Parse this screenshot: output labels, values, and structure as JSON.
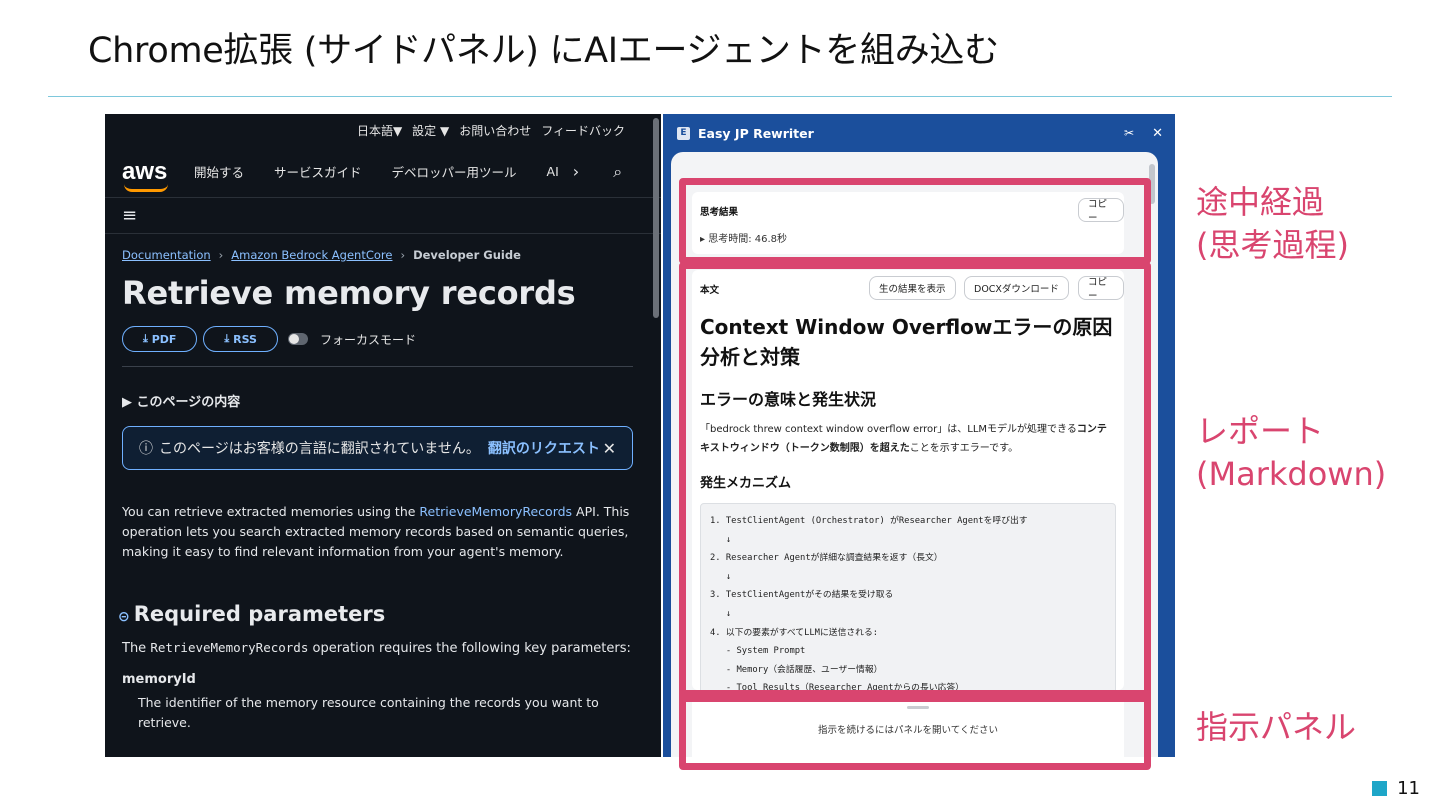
{
  "slide": {
    "title": "Chrome拡張 (サイドパネル) にAIエージェントを組み込む",
    "page_number": "11",
    "accent_color": "#1ea6c8",
    "highlight_color": "#d9456f"
  },
  "annotations": {
    "thinking": [
      "途中経過",
      "(思考過程)"
    ],
    "report": [
      "レポート",
      "(Markdown)"
    ],
    "instruction": "指示パネル"
  },
  "aws": {
    "topbar": {
      "language": "日本語▼",
      "settings": "設定 ▼",
      "contact": "お問い合わせ",
      "feedback": "フィードバック"
    },
    "logo": "aws",
    "nav": [
      "開始する",
      "サービスガイド",
      "デベロッパー用ツール",
      "AI"
    ],
    "menu_icon": "≡",
    "breadcrumb": [
      "Documentation",
      "Amazon Bedrock AgentCore",
      "Developer Guide"
    ],
    "page_title": "Retrieve memory records",
    "buttons": {
      "pdf": "PDF",
      "rss": "RSS"
    },
    "focus_mode": "フォーカスモード",
    "toc": "▶ このページの内容",
    "notice": {
      "text": "このページはお客様の言語に翻訳されていません。",
      "request": "翻訳のリクエスト"
    },
    "intro": {
      "before": "You can retrieve extracted memories using the ",
      "link": "RetrieveMemoryRecords",
      "after": " API. This operation lets you search extracted memory records based on semantic queries, making it easy to find relevant information from your agent's memory."
    },
    "section_title": "Required parameters",
    "section_text": {
      "before": "The ",
      "code": "RetrieveMemoryRecords",
      "after": " operation requires the following key parameters:"
    },
    "param": {
      "name": "memoryId",
      "description": "The identifier of the memory resource containing the records you want to retrieve."
    }
  },
  "extension": {
    "badge": "E",
    "title": "Easy JP Rewriter",
    "header_color": "#1b4f9c",
    "thinking": {
      "label": "思考結果",
      "copy": "コピー",
      "summary": "▸ 思考時間: 46.8秒"
    },
    "body": {
      "label": "本文",
      "show_raw": "生の結果を表示",
      "docx": "DOCXダウンロード",
      "copy": "コピー",
      "h1": "Context Window Overflowエラーの原因分析と対策",
      "h2": "エラーの意味と発生状況",
      "p_before": "「bedrock threw context window overflow error」は、LLMモデルが処理できる",
      "p_bold": "コンテキストウィンドウ（トークン数制限）を超えた",
      "p_after": "ことを示すエラーです。",
      "h3": "発生メカニズム",
      "code_lines": [
        "1. TestClientAgent (Orchestrator) がResearcher Agentを呼び出す",
        "   ↓",
        "2. Researcher Agentが詳細な調査結果を返す（長文）",
        "   ↓",
        "3. TestClientAgentがその結果を受け取る",
        "   ↓",
        "4. 以下の要素がすべてLLMに送信される:",
        "   - System Prompt",
        "   - Memory（会話履歴、ユーザー情報）",
        "   - Tool Results（Researcher Agentからの長い応答）"
      ]
    },
    "instruction_placeholder": "指示を続けるにはパネルを開いてください"
  }
}
